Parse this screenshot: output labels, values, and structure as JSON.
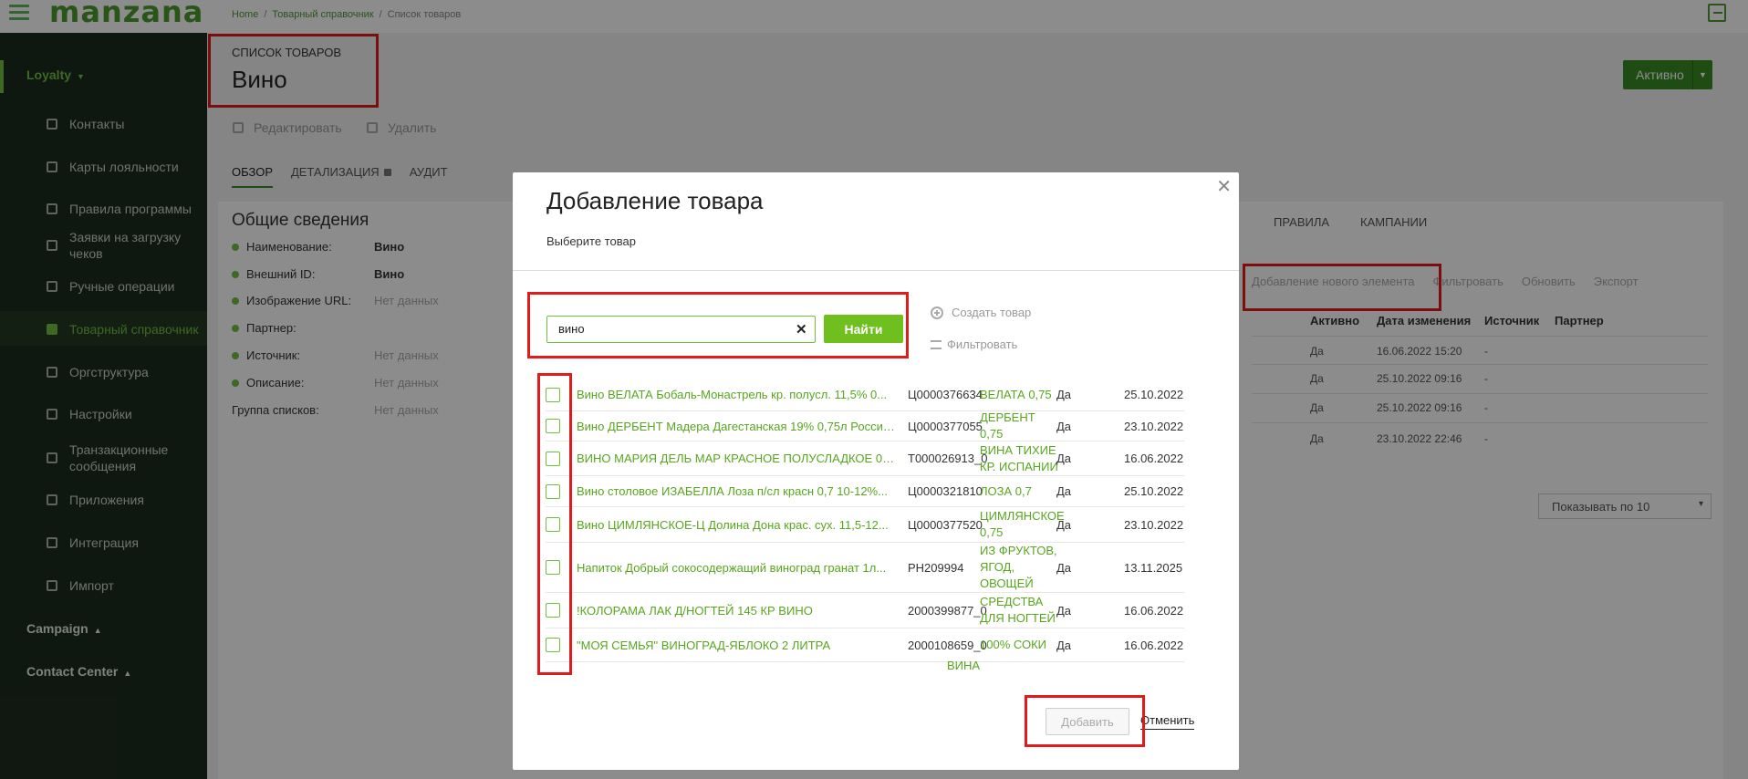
{
  "topbar": {
    "logo": "manzana",
    "breadcrumbs": [
      "Home",
      "Товарный справочник",
      "Список товаров"
    ]
  },
  "sidebar": {
    "loyalty": "Loyalty",
    "items": [
      {
        "label": "Контакты",
        "icon": "contacts-icon"
      },
      {
        "label": "Карты лояльности",
        "icon": "card-icon"
      },
      {
        "label": "Правила программы",
        "icon": "share-icon"
      },
      {
        "label": "Заявки на загрузку чеков",
        "icon": "receipt-icon"
      },
      {
        "label": "Ручные операции",
        "icon": "hand-icon"
      },
      {
        "label": "Товарный справочник",
        "icon": "grid-icon"
      },
      {
        "label": "Оргструктура",
        "icon": "layers-icon"
      },
      {
        "label": "Настройки",
        "icon": "wrench-icon"
      },
      {
        "label": "Транзакционные сообщения",
        "icon": "sync-icon"
      },
      {
        "label": "Приложения",
        "icon": "copy-icon"
      },
      {
        "label": "Интеграция",
        "icon": "plug-icon"
      },
      {
        "label": "Импорт",
        "icon": "cloud-upload-icon"
      }
    ],
    "campaign": "Campaign",
    "contact_center": "Contact Center"
  },
  "page": {
    "subtitle": "СПИСОК ТОВАРОВ",
    "title": "Вино",
    "status": "Активно",
    "edit": "Редактировать",
    "delete": "Удалить",
    "tabs": [
      "ОБЗОР",
      "ДЕТАЛИЗАЦИЯ",
      "АУДИТ"
    ]
  },
  "info": {
    "title": "Общие сведения",
    "rows": [
      {
        "label": "Наименование:",
        "value": "Вино"
      },
      {
        "label": "Внешний ID:",
        "value": "Вино"
      },
      {
        "label": "Изображение URL:",
        "value": "Нет данных"
      },
      {
        "label": "Партнер:",
        "value": ""
      },
      {
        "label": "Источник:",
        "value": "Нет данных"
      },
      {
        "label": "Описание:",
        "value": "Нет данных"
      },
      {
        "label": "Группа списков:",
        "value": "Нет данных"
      }
    ]
  },
  "background_table": {
    "tabs": [
      "ПРАВИЛА",
      "КАМПАНИИ"
    ],
    "toolbar": [
      "Добавление нового элемента",
      "Фильтровать",
      "Обновить",
      "Экспорт"
    ],
    "headers": [
      "Активно",
      "Дата изменения",
      "Источник",
      "Партнер"
    ],
    "rows": [
      [
        "Да",
        "16.06.2022 15:20",
        "-"
      ],
      [
        "Да",
        "25.10.2022 09:16",
        "-"
      ],
      [
        "Да",
        "25.10.2022 09:16",
        "-"
      ],
      [
        "Да",
        "23.10.2022 22:46",
        "-"
      ]
    ],
    "page_size": "Показывать по 10"
  },
  "modal": {
    "title": "Добавление товара",
    "subtitle": "Выберите товар",
    "search_value": "вино",
    "find": "Найти",
    "create": "Создать товар",
    "filter": "Фильтровать",
    "add": "Добавить",
    "cancel": "Отменить",
    "results": [
      {
        "name": "Вино ВЕЛАТА Бобаль-Монастрель кр. полусл. 11,5% 0...",
        "code": "Ц0000376634",
        "group": "ВЕЛАТА 0,75",
        "active": "Да",
        "date": "25.10.2022 ("
      },
      {
        "name": "Вино ДЕРБЕНТ Мадера Дагестанская 19% 0,75л Россия...",
        "code": "Ц0000377055",
        "group": "ДЕРБЕНТ 0,75",
        "active": "Да",
        "date": "23.10.2022 2"
      },
      {
        "name": "ВИНО МАРИЯ ДЕЛЬ МАР КРАСНОЕ ПОЛУСЛАДКОЕ 0,75Л",
        "code": "Т000026913_0",
        "group": "ВИНА ТИХИЕ КР. ИСПАНИИ",
        "active": "Да",
        "date": "16.06.2022 1"
      },
      {
        "name": "Вино столовое ИЗАБЕЛЛА Лоза п/сл красн 0,7 10-12%...",
        "code": "Ц0000321810",
        "group": "ЛОЗА 0,7",
        "active": "Да",
        "date": "25.10.2022 ("
      },
      {
        "name": "Вино ЦИМЛЯНСКОЕ-Ц Долина Дона крас. сух. 11,5-12...",
        "code": "Ц0000377520",
        "group": "ЦИМЛЯНСКОЕ 0,75",
        "active": "Да",
        "date": "23.10.2022 2"
      },
      {
        "name": "Напиток Добрый сокосодержащий виноград гранат 1л...",
        "code": "PH209994",
        "group": "ИЗ ФРУКТОВ, ЯГОД, ОВОЩЕЙ",
        "active": "Да",
        "date": "13.11.2025 ("
      },
      {
        "name": "!КОЛОРАМА ЛАК Д/НОГТЕЙ 145 КР ВИНО",
        "code": "2000399877_0",
        "group": "СРЕДСТВА ДЛЯ НОГТЕЙ",
        "active": "Да",
        "date": "16.06.2022 1"
      },
      {
        "name": "\"МОЯ СЕМЬЯ\" ВИНОГРАД-ЯБЛОКО 2 ЛИТРА",
        "code": "2000108659_0",
        "group": "100% СОКИ",
        "active": "Да",
        "date": "16.06.2022 1"
      }
    ],
    "partial_group": "ВИНА"
  },
  "colors": {
    "accent": "#6fbf3f",
    "highlight": "#e31a1a",
    "sidebar": "#1d2b1f"
  }
}
